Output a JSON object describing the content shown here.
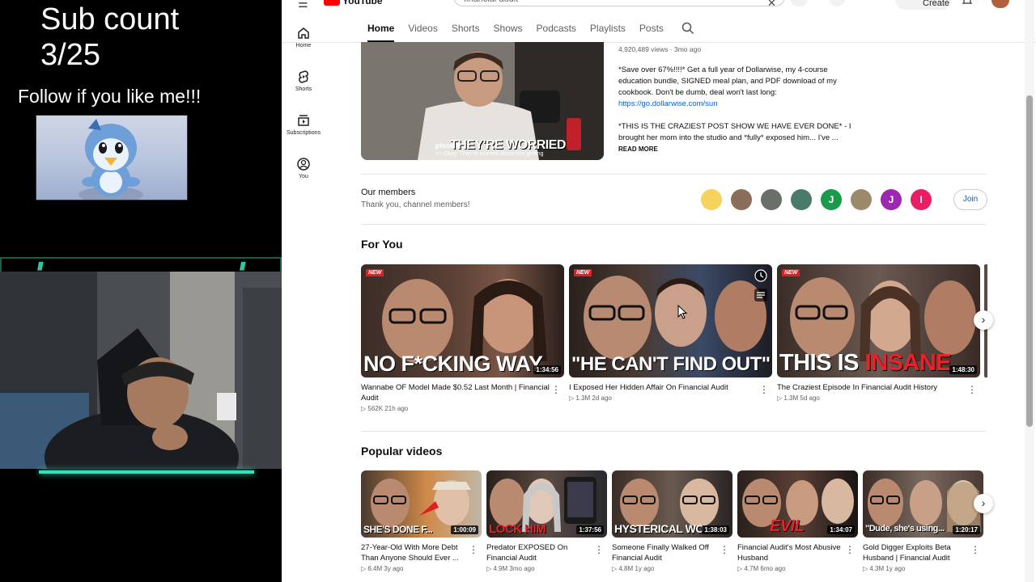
{
  "overlay": {
    "sub_count_label": "Sub count",
    "sub_count_value": "3/25",
    "follow_text": "Follow if you like me!!!"
  },
  "yt": {
    "search_value": "financial audit",
    "create_label": "Create",
    "guide": [
      {
        "label": "Home",
        "icon": "home-icon"
      },
      {
        "label": "Shorts",
        "icon": "shorts-icon"
      },
      {
        "label": "Subscriptions",
        "icon": "subscriptions-icon"
      },
      {
        "label": "You",
        "icon": "account-icon"
      }
    ],
    "tabs": [
      "Home",
      "Videos",
      "Shorts",
      "Shows",
      "Podcasts",
      "Playlists",
      "Posts"
    ],
    "active_tab": "Home",
    "featured": {
      "caption_small": "pissed off",
      "caption_big": "THEY'RE WORRIED",
      "caption_sub": ">> Okay. They're worried about him getting",
      "stats": "4,920,489 views · 3mo ago",
      "desc_1": "*Save over 67%!!!!* Get a full year of Dollarwise, my 4-course education bundle, SIGNED meal plan, and PDF download of my cookbook. Don't be dumb, deal won't last long:",
      "link": "https://go.dollarwise.com/sun",
      "desc_2": "*THIS IS THE CRAZIEST POST SHOW WE HAVE EVER DONE* - I brought her mom into the studio and *fully* exposed him... I've ...",
      "read_more": "READ MORE"
    },
    "members": {
      "title": "Our members",
      "subtitle": "Thank you, channel members!",
      "avatars": [
        {
          "letter": "",
          "color": "#f4d35e"
        },
        {
          "letter": "",
          "color": "#8a6d5a"
        },
        {
          "letter": "",
          "color": "#6b6f6a"
        },
        {
          "letter": "",
          "color": "#4a7a6a"
        },
        {
          "letter": "J",
          "color": "#1a9a4a"
        },
        {
          "letter": "",
          "color": "#9a8a6a"
        },
        {
          "letter": "J",
          "color": "#9c27b0"
        },
        {
          "letter": "I",
          "color": "#e91e63"
        }
      ],
      "join_label": "Join"
    },
    "for_you": {
      "title": "For You",
      "videos": [
        {
          "thumb_text": "NO F*CKING WAY",
          "duration": "1:34:56",
          "new": "NEW",
          "title": "Wannabe OF Model Made $0.52 Last Month | Financial Audit",
          "views": "562K",
          "age": "21h ago"
        },
        {
          "thumb_text": "\"HE CAN'T FIND OUT\"",
          "duration": "",
          "new": "NEW",
          "title": "I Exposed Her Hidden Affair On Financial Audit",
          "views": "1.3M",
          "age": "2d ago"
        },
        {
          "thumb_text_a": "THIS IS ",
          "thumb_text_b": "INSANE",
          "duration": "1:48:30",
          "new": "NEW",
          "title": "The Craziest Episode In Financial Audit History",
          "views": "1.3M",
          "age": "5d ago"
        }
      ]
    },
    "popular": {
      "title": "Popular videos",
      "videos": [
        {
          "thumb_text": "SHE'S DONE F...",
          "duration": "1:00:09",
          "title": "27-Year-Old With More Debt Than Anyone Should Ever ...",
          "views": "6.4M",
          "age": "3y ago"
        },
        {
          "thumb_text": "LOCK HIM",
          "duration": "1:37:56",
          "title": "Predator EXPOSED On Financial Audit",
          "views": "4.9M",
          "age": "3mo ago"
        },
        {
          "thumb_text": "HYSTERICAL WO...",
          "duration": "1:38:03",
          "title": "Someone Finally Walked Off Financial Audit",
          "views": "4.8M",
          "age": "1y ago"
        },
        {
          "thumb_text": "EVIL",
          "duration": "1:34:07",
          "title": "Financial Audit's Most Abusive Husband",
          "views": "4.7M",
          "age": "6mo ago"
        },
        {
          "thumb_text": "\"Dude, she's using...",
          "duration": "1:20:17",
          "title": "Gold Digger Exploits Beta Husband | Financial Audit",
          "views": "4.3M",
          "age": "1y ago"
        }
      ]
    },
    "dot_sep": "·"
  }
}
